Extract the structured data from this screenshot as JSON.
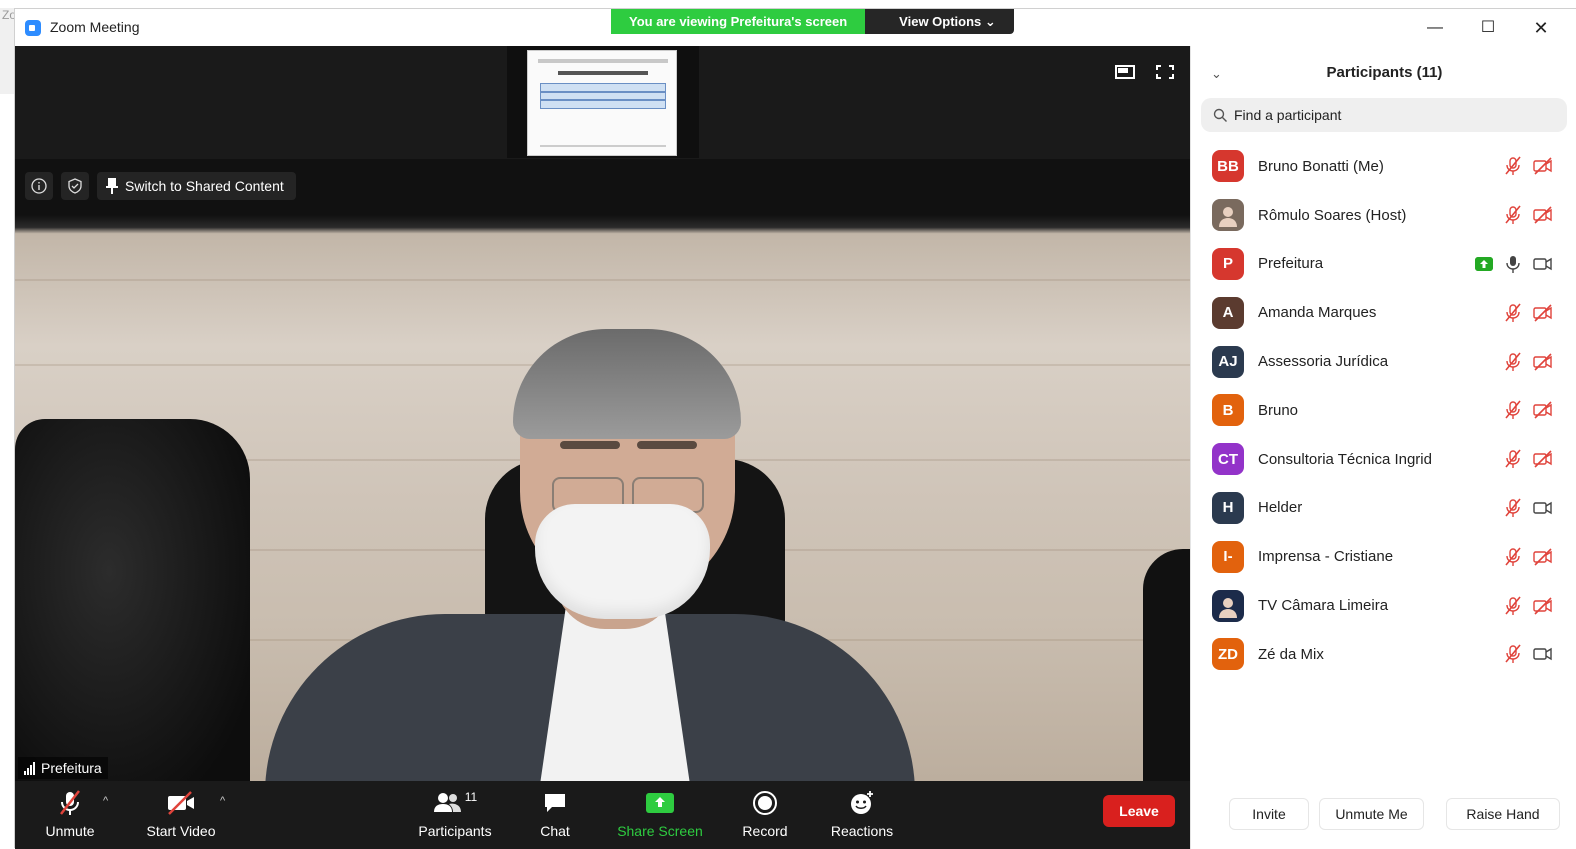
{
  "window": {
    "stray_label": "Zo",
    "title": "Zoom Meeting",
    "min_glyph": "—",
    "max_glyph": "☐",
    "close_glyph": "✕"
  },
  "banner": {
    "viewing_text": "You are viewing Prefeitura's screen",
    "view_options": "View Options ⌄"
  },
  "video": {
    "switch_label": "Switch to Shared Content",
    "speaker_name": "Prefeitura"
  },
  "toolbar": {
    "unmute": "Unmute",
    "start_video": "Start Video",
    "participants": "Participants",
    "participants_count": "11",
    "chat": "Chat",
    "share_screen": "Share Screen",
    "record": "Record",
    "reactions": "Reactions",
    "leave": "Leave",
    "caret": "^"
  },
  "panel": {
    "title": "Participants (11)",
    "collapse": "⌄",
    "search_placeholder": "Find a participant",
    "participants": [
      {
        "initials": "BB",
        "name": "Bruno Bonatti (Me)",
        "color": "#d6372e",
        "mic": "muted",
        "cam": "off"
      },
      {
        "initials": "",
        "name": "Rômulo Soares (Host)",
        "color": "#7a6a5e",
        "mic": "muted",
        "cam": "off"
      },
      {
        "initials": "P",
        "name": "Prefeitura",
        "color": "#d6372e",
        "mic": "on",
        "cam": "on",
        "sharing": true
      },
      {
        "initials": "A",
        "name": "Amanda Marques",
        "color": "#5b3b2f",
        "mic": "muted",
        "cam": "off"
      },
      {
        "initials": "AJ",
        "name": "Assessoria Jurídica",
        "color": "#2b3a4f",
        "mic": "muted",
        "cam": "off"
      },
      {
        "initials": "B",
        "name": "Bruno",
        "color": "#e2620d",
        "mic": "muted",
        "cam": "off"
      },
      {
        "initials": "CT",
        "name": "Consultoria Técnica Ingrid",
        "color": "#9333c9",
        "mic": "muted",
        "cam": "off"
      },
      {
        "initials": "H",
        "name": "Helder",
        "color": "#2b3a4f",
        "mic": "muted",
        "cam": "on"
      },
      {
        "initials": "I-",
        "name": "Imprensa - Cristiane",
        "color": "#e2620d",
        "mic": "muted",
        "cam": "off"
      },
      {
        "initials": "",
        "name": "TV Câmara Limeira",
        "color": "#1c2b4a",
        "mic": "muted",
        "cam": "off"
      },
      {
        "initials": "ZD",
        "name": "Zé da Mix",
        "color": "#e2620d",
        "mic": "muted",
        "cam": "on"
      }
    ],
    "invite": "Invite",
    "unmute_me": "Unmute Me",
    "raise_hand": "Raise Hand"
  },
  "colors": {
    "banner_green": "#2ecc40",
    "leave_red": "#d9201e",
    "muted_red": "#e0433b",
    "zoom_blue": "#2d8cff"
  }
}
